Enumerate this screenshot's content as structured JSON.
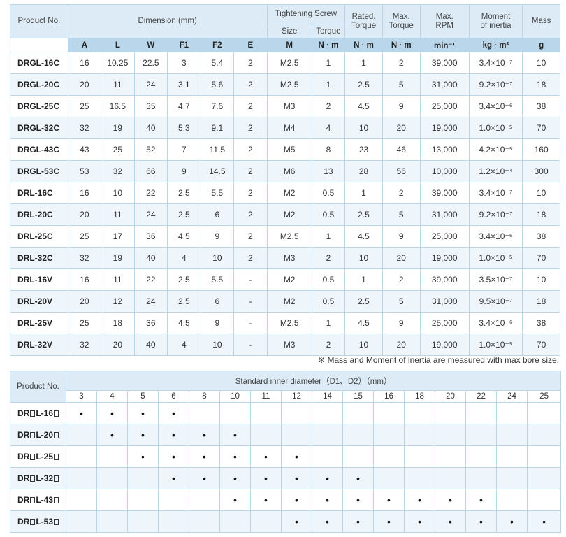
{
  "spec_table": {
    "col_product": "Product No.",
    "group_dimension": "Dimension (mm)",
    "group_screw": "Tightening Screw",
    "screw_size": "Size",
    "screw_torque": "Torque",
    "rated_torque": "Rated.\nTorque",
    "rated_torque_l1": "Rated.",
    "rated_torque_l2": "Torque",
    "max_torque_l1": "Max.",
    "max_torque_l2": "Torque",
    "max_rpm_l1": "Max.",
    "max_rpm_l2": "RPM",
    "moment_l1": "Moment",
    "moment_l2": "of inertia",
    "mass": "Mass",
    "units": [
      "A",
      "L",
      "W",
      "F1",
      "F2",
      "E",
      "M",
      "N · m",
      "N · m",
      "N · m",
      "min⁻¹",
      "kg · m²",
      "g"
    ],
    "rows": [
      [
        "DRGL-16C",
        "16",
        "10.25",
        "22.5",
        "3",
        "5.4",
        "2",
        "M2.5",
        "1",
        "1",
        "2",
        "39,000",
        "3.4×10⁻⁷",
        "10"
      ],
      [
        "DRGL-20C",
        "20",
        "11",
        "24",
        "3.1",
        "5.6",
        "2",
        "M2.5",
        "1",
        "2.5",
        "5",
        "31,000",
        "9.2×10⁻⁷",
        "18"
      ],
      [
        "DRGL-25C",
        "25",
        "16.5",
        "35",
        "4.7",
        "7.6",
        "2",
        "M3",
        "2",
        "4.5",
        "9",
        "25,000",
        "3.4×10⁻⁶",
        "38"
      ],
      [
        "DRGL-32C",
        "32",
        "19",
        "40",
        "5.3",
        "9.1",
        "2",
        "M4",
        "4",
        "10",
        "20",
        "19,000",
        "1.0×10⁻⁵",
        "70"
      ],
      [
        "DRGL-43C",
        "43",
        "25",
        "52",
        "7",
        "11.5",
        "2",
        "M5",
        "8",
        "23",
        "46",
        "13,000",
        "4.2×10⁻⁵",
        "160"
      ],
      [
        "DRGL-53C",
        "53",
        "32",
        "66",
        "9",
        "14.5",
        "2",
        "M6",
        "13",
        "28",
        "56",
        "10,000",
        "1.2×10⁻⁴",
        "300"
      ],
      [
        "DRL-16C",
        "16",
        "10",
        "22",
        "2.5",
        "5.5",
        "2",
        "M2",
        "0.5",
        "1",
        "2",
        "39,000",
        "3.4×10⁻⁷",
        "10"
      ],
      [
        "DRL-20C",
        "20",
        "11",
        "24",
        "2.5",
        "6",
        "2",
        "M2",
        "0.5",
        "2.5",
        "5",
        "31,000",
        "9.2×10⁻⁷",
        "18"
      ],
      [
        "DRL-25C",
        "25",
        "17",
        "36",
        "4.5",
        "9",
        "2",
        "M2.5",
        "1",
        "4.5",
        "9",
        "25,000",
        "3.4×10⁻⁶",
        "38"
      ],
      [
        "DRL-32C",
        "32",
        "19",
        "40",
        "4",
        "10",
        "2",
        "M3",
        "2",
        "10",
        "20",
        "19,000",
        "1.0×10⁻⁵",
        "70"
      ],
      [
        "DRL-16V",
        "16",
        "11",
        "22",
        "2.5",
        "5.5",
        "-",
        "M2",
        "0.5",
        "1",
        "2",
        "39,000",
        "3.5×10⁻⁷",
        "10"
      ],
      [
        "DRL-20V",
        "20",
        "12",
        "24",
        "2.5",
        "6",
        "-",
        "M2",
        "0.5",
        "2.5",
        "5",
        "31,000",
        "9.5×10⁻⁷",
        "18"
      ],
      [
        "DRL-25V",
        "25",
        "18",
        "36",
        "4.5",
        "9",
        "-",
        "M2.5",
        "1",
        "4.5",
        "9",
        "25,000",
        "3.4×10⁻⁶",
        "38"
      ],
      [
        "DRL-32V",
        "32",
        "20",
        "40",
        "4",
        "10",
        "-",
        "M3",
        "2",
        "10",
        "20",
        "19,000",
        "1.0×10⁻⁵",
        "70"
      ]
    ]
  },
  "note": "※ Mass and Moment of inertia are measured with max bore size.",
  "bore_table": {
    "col_product": "Product No.",
    "group_label": "Standard inner diameter（D1、D2）（mm）",
    "sizes": [
      "3",
      "4",
      "5",
      "6",
      "8",
      "10",
      "11",
      "12",
      "14",
      "15",
      "16",
      "18",
      "20",
      "22",
      "24",
      "25"
    ],
    "rows": [
      {
        "prefix": "DR",
        "suffix": "L-16",
        "dots": [
          1,
          1,
          1,
          1,
          0,
          0,
          0,
          0,
          0,
          0,
          0,
          0,
          0,
          0,
          0,
          0
        ]
      },
      {
        "prefix": "DR",
        "suffix": "L-20",
        "dots": [
          0,
          1,
          1,
          1,
          1,
          1,
          0,
          0,
          0,
          0,
          0,
          0,
          0,
          0,
          0,
          0
        ]
      },
      {
        "prefix": "DR",
        "suffix": "L-25",
        "dots": [
          0,
          0,
          1,
          1,
          1,
          1,
          1,
          1,
          0,
          0,
          0,
          0,
          0,
          0,
          0,
          0
        ]
      },
      {
        "prefix": "DR",
        "suffix": "L-32",
        "dots": [
          0,
          0,
          0,
          1,
          1,
          1,
          1,
          1,
          1,
          1,
          0,
          0,
          0,
          0,
          0,
          0
        ]
      },
      {
        "prefix": "DR",
        "suffix": "L-43",
        "dots": [
          0,
          0,
          0,
          0,
          0,
          1,
          1,
          1,
          1,
          1,
          1,
          1,
          1,
          1,
          0,
          0
        ]
      },
      {
        "prefix": "DR",
        "suffix": "L-53",
        "dots": [
          0,
          0,
          0,
          0,
          0,
          0,
          0,
          1,
          1,
          1,
          1,
          1,
          1,
          1,
          1,
          1
        ]
      }
    ]
  },
  "colors": {
    "header_light": "#dcebf5",
    "header_dark": "#b9d6ea",
    "row_alt": "#eef5fb",
    "border": "#b9d6e8"
  }
}
